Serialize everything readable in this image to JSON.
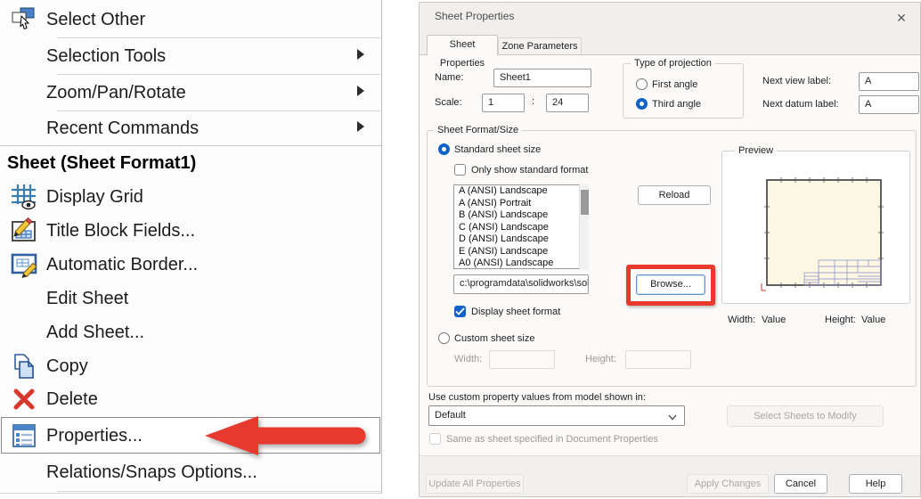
{
  "menu": {
    "items": [
      {
        "label": "Select Other"
      },
      {
        "label": "Selection Tools"
      },
      {
        "label": "Zoom/Pan/Rotate"
      },
      {
        "label": "Recent Commands"
      },
      {
        "label": "Sheet (Sheet Format1)"
      },
      {
        "label": "Display Grid"
      },
      {
        "label": "Title Block Fields..."
      },
      {
        "label": "Automatic Border..."
      },
      {
        "label": "Edit Sheet"
      },
      {
        "label": "Add Sheet..."
      },
      {
        "label": "Copy"
      },
      {
        "label": "Delete"
      },
      {
        "label": "Properties..."
      },
      {
        "label": "Relations/Snaps Options..."
      }
    ]
  },
  "dialog": {
    "title": "Sheet Properties",
    "close_glyph": "✕",
    "tabs": {
      "active": "Sheet Properties",
      "inactive": "Zone Parameters"
    },
    "name": {
      "label": "Name:",
      "value": "Sheet1"
    },
    "scale": {
      "label": "Scale:",
      "value1": "1",
      "separator": ":",
      "value2": "24"
    },
    "projection": {
      "legend": "Type of projection",
      "first": "First angle",
      "third": "Third angle",
      "selected": "Third angle"
    },
    "next_view": {
      "label": "Next view label:",
      "value": "A"
    },
    "next_datum": {
      "label": "Next datum label:",
      "value": "A"
    },
    "sheet_format": {
      "legend": "Sheet Format/Size",
      "standard_radio": "Standard sheet size",
      "only_show_checkbox": "Only show standard format",
      "formats": [
        "A (ANSI) Landscape",
        "A (ANSI) Portrait",
        "B (ANSI) Landscape",
        "C (ANSI) Landscape",
        "D (ANSI) Landscape",
        "E (ANSI) Landscape",
        "A0 (ANSI) Landscape"
      ],
      "path_value": "c:\\programdata\\solidworks\\solid",
      "reload_button": "Reload",
      "browse_button": "Browse...",
      "display_checkbox": "Display sheet format",
      "custom_radio": "Custom sheet size",
      "width_label": "Width:",
      "height_label": "Height:"
    },
    "preview": {
      "legend": "Preview",
      "width_label": "Width:",
      "width_value": "Value",
      "height_label": "Height:",
      "height_value": "Value"
    },
    "custom_property": {
      "label": "Use custom property values from model shown in:",
      "dropdown_value": "Default",
      "same_as_checkbox": "Same as sheet specified in Document Properties",
      "select_sheets_button": "Select Sheets to Modify"
    },
    "footer": {
      "update_all_button": "Update All Properties",
      "apply_button": "Apply Changes",
      "cancel_button": "Cancel",
      "help_button": "Help"
    }
  },
  "colors": {
    "accent_blue": "#0f62c7",
    "highlight_red": "#e8392f",
    "sheet_paper": "#fcf7e3"
  }
}
